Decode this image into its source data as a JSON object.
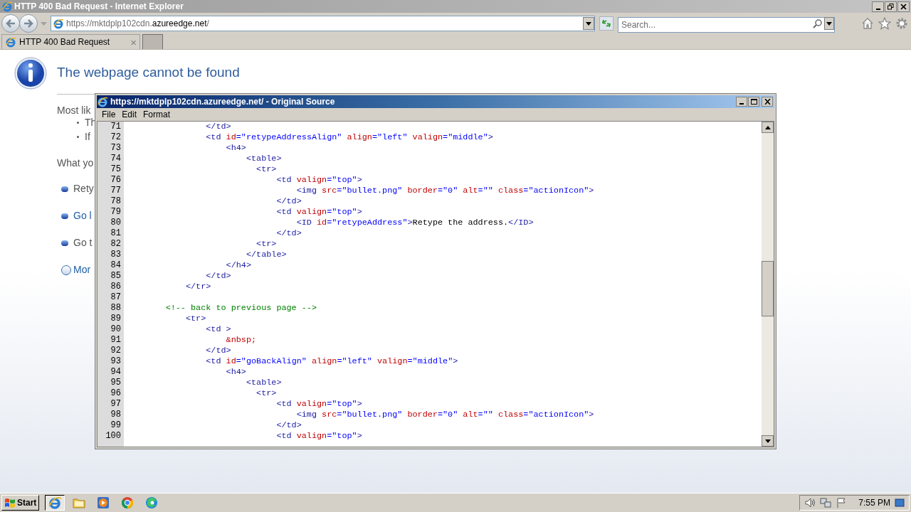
{
  "window": {
    "title": "HTTP 400 Bad Request - Internet Explorer"
  },
  "address_bar": {
    "url_start": "https://mktdplp102cdn.",
    "url_domain": "azureedge.net",
    "url_end": "/"
  },
  "search": {
    "placeholder": "Search..."
  },
  "tabs": [
    {
      "label": "HTTP 400 Bad Request",
      "close": "×",
      "selected": true
    }
  ],
  "page": {
    "heading": "The webpage cannot be found",
    "fragments": [
      {
        "kind": "text",
        "text": "Most lik"
      },
      {
        "kind": "bullet",
        "text": "Th"
      },
      {
        "kind": "bullet",
        "text": "If"
      },
      {
        "kind": "text",
        "text": "What yo"
      },
      {
        "kind": "action",
        "text": "Rety",
        "link": false
      },
      {
        "kind": "action",
        "text": "Go l",
        "link": true
      },
      {
        "kind": "action",
        "text": "Go t",
        "link": false
      },
      {
        "kind": "more",
        "text": "Mor",
        "link": true
      }
    ]
  },
  "source_window": {
    "title": "https://mktdplp102cdn.azureedge.net/ - Original Source",
    "menu": [
      "File",
      "Edit",
      "Format"
    ],
    "lines": [
      {
        "number": "71",
        "tokens": [
          {
            "kind": "tag",
            "text": "                </td>"
          }
        ]
      },
      {
        "number": "72",
        "tokens": [
          {
            "kind": "tag",
            "text": "                <td"
          },
          {
            "kind": "attr",
            "text": " id"
          },
          {
            "kind": "value",
            "text": "=\"retypeAddressAlign\""
          },
          {
            "kind": "attr",
            "text": " align"
          },
          {
            "kind": "value",
            "text": "=\"left\""
          },
          {
            "kind": "attr",
            "text": " valign"
          },
          {
            "kind": "value",
            "text": "=\"middle\""
          },
          {
            "kind": "tag",
            "text": ">"
          }
        ]
      },
      {
        "number": "73",
        "tokens": [
          {
            "kind": "tag",
            "text": "                    <h4>"
          }
        ]
      },
      {
        "number": "74",
        "tokens": [
          {
            "kind": "tag",
            "text": "                        <table>"
          }
        ]
      },
      {
        "number": "75",
        "tokens": [
          {
            "kind": "tag",
            "text": "                          <tr>"
          }
        ]
      },
      {
        "number": "76",
        "tokens": [
          {
            "kind": "tag",
            "text": "                              <td"
          },
          {
            "kind": "attr",
            "text": " valign"
          },
          {
            "kind": "value",
            "text": "=\"top\""
          },
          {
            "kind": "tag",
            "text": ">"
          }
        ]
      },
      {
        "number": "77",
        "tokens": [
          {
            "kind": "tag",
            "text": "                                  <img"
          },
          {
            "kind": "attr",
            "text": " src"
          },
          {
            "kind": "value",
            "text": "=\"bullet.png\""
          },
          {
            "kind": "attr",
            "text": " border"
          },
          {
            "kind": "value",
            "text": "=\"0\""
          },
          {
            "kind": "attr",
            "text": " alt"
          },
          {
            "kind": "value",
            "text": "=\"\""
          },
          {
            "kind": "attr",
            "text": " class"
          },
          {
            "kind": "value",
            "text": "=\"actionIcon\""
          },
          {
            "kind": "tag",
            "text": ">"
          }
        ]
      },
      {
        "number": "78",
        "tokens": [
          {
            "kind": "tag",
            "text": "                              </td>"
          }
        ]
      },
      {
        "number": "79",
        "tokens": [
          {
            "kind": "tag",
            "text": "                              <td"
          },
          {
            "kind": "attr",
            "text": " valign"
          },
          {
            "kind": "value",
            "text": "=\"top\""
          },
          {
            "kind": "tag",
            "text": ">"
          }
        ]
      },
      {
        "number": "80",
        "tokens": [
          {
            "kind": "tag",
            "text": "                                  <ID"
          },
          {
            "kind": "attr",
            "text": " id"
          },
          {
            "kind": "value",
            "text": "=\"retypeAddress\""
          },
          {
            "kind": "tag",
            "text": ">"
          },
          {
            "kind": "text",
            "text": "Retype the address."
          },
          {
            "kind": "tag",
            "text": "</ID>"
          }
        ]
      },
      {
        "number": "81",
        "tokens": [
          {
            "kind": "tag",
            "text": "                              </td>"
          }
        ]
      },
      {
        "number": "82",
        "tokens": [
          {
            "kind": "tag",
            "text": "                          <tr>"
          }
        ]
      },
      {
        "number": "83",
        "tokens": [
          {
            "kind": "tag",
            "text": "                        </table>"
          }
        ]
      },
      {
        "number": "84",
        "tokens": [
          {
            "kind": "tag",
            "text": "                    </h4>"
          }
        ]
      },
      {
        "number": "85",
        "tokens": [
          {
            "kind": "tag",
            "text": "                </td>"
          }
        ]
      },
      {
        "number": "86",
        "tokens": [
          {
            "kind": "tag",
            "text": "            </tr>"
          }
        ]
      },
      {
        "number": "87"
      },
      {
        "number": "88",
        "tokens": [
          {
            "kind": "comment",
            "text": "        <!-- back to previous page -->"
          }
        ]
      },
      {
        "number": "89",
        "tokens": [
          {
            "kind": "tag",
            "text": "            <tr>"
          }
        ]
      },
      {
        "number": "90",
        "tokens": [
          {
            "kind": "tag",
            "text": "                <td >"
          }
        ]
      },
      {
        "number": "91",
        "tokens": [
          {
            "kind": "entity",
            "text": "                    &nbsp;"
          }
        ]
      },
      {
        "number": "92",
        "tokens": [
          {
            "kind": "tag",
            "text": "                </td>"
          }
        ]
      },
      {
        "number": "93",
        "tokens": [
          {
            "kind": "tag",
            "text": "                <td"
          },
          {
            "kind": "attr",
            "text": " id"
          },
          {
            "kind": "value",
            "text": "=\"goBackAlign\""
          },
          {
            "kind": "attr",
            "text": " align"
          },
          {
            "kind": "value",
            "text": "=\"left\""
          },
          {
            "kind": "attr",
            "text": " valign"
          },
          {
            "kind": "value",
            "text": "=\"middle\""
          },
          {
            "kind": "tag",
            "text": ">"
          }
        ]
      },
      {
        "number": "94",
        "tokens": [
          {
            "kind": "tag",
            "text": "                    <h4>"
          }
        ]
      },
      {
        "number": "95",
        "tokens": [
          {
            "kind": "tag",
            "text": "                        <table>"
          }
        ]
      },
      {
        "number": "96",
        "tokens": [
          {
            "kind": "tag",
            "text": "                          <tr>"
          }
        ]
      },
      {
        "number": "97",
        "tokens": [
          {
            "kind": "tag",
            "text": "                              <td"
          },
          {
            "kind": "attr",
            "text": " valign"
          },
          {
            "kind": "value",
            "text": "=\"top\""
          },
          {
            "kind": "tag",
            "text": ">"
          }
        ]
      },
      {
        "number": "98",
        "tokens": [
          {
            "kind": "tag",
            "text": "                                  <img"
          },
          {
            "kind": "attr",
            "text": " src"
          },
          {
            "kind": "value",
            "text": "=\"bullet.png\""
          },
          {
            "kind": "attr",
            "text": " border"
          },
          {
            "kind": "value",
            "text": "=\"0\""
          },
          {
            "kind": "attr",
            "text": " alt"
          },
          {
            "kind": "value",
            "text": "=\"\""
          },
          {
            "kind": "attr",
            "text": " class"
          },
          {
            "kind": "value",
            "text": "=\"actionIcon\""
          },
          {
            "kind": "tag",
            "text": ">"
          }
        ]
      },
      {
        "number": "99",
        "tokens": [
          {
            "kind": "tag",
            "text": "                              </td>"
          }
        ]
      },
      {
        "number": "100",
        "tokens": [
          {
            "kind": "tag",
            "text": "                              <td"
          },
          {
            "kind": "attr",
            "text": " valign"
          },
          {
            "kind": "value",
            "text": "=\"top\""
          },
          {
            "kind": "tag",
            "text": ">"
          }
        ]
      }
    ]
  },
  "taskbar": {
    "start": "Start",
    "apps": [
      {
        "kind": "ie",
        "selected": true
      },
      {
        "kind": "folder",
        "selected": false
      },
      {
        "kind": "media",
        "selected": false
      },
      {
        "kind": "chrome",
        "selected": false
      },
      {
        "kind": "edge",
        "selected": false
      }
    ],
    "clock": "7:55 PM"
  }
}
